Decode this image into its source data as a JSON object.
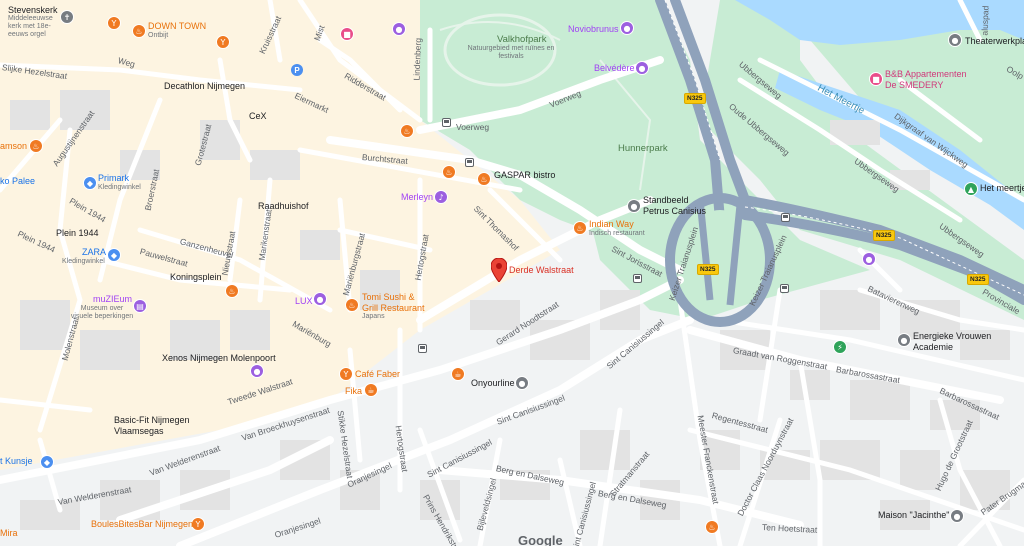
{
  "map": {
    "labels": {
      "stevenskerk": "Stevenskerk",
      "stevenskerk_sub": "Middeleeuwse kerk met 18e-eeuws orgel",
      "down_town": "DOWN TOWN",
      "down_town_sub": "Ontbijt",
      "decathlon": "Decathlon Nijmegen",
      "cex": "CeX",
      "samson": "amson",
      "primark": "Primark",
      "primark_sub": "Kledingwinkel",
      "ko_palee": "ko Palee",
      "plein1944": "Plein 1944",
      "raadhuishof": "Raadhuishof",
      "zara": "ZARA",
      "zara_sub": "Kledingwinkel",
      "koningsplein": "Koningsplein",
      "muzieum": "muZIEum",
      "muzieum_sub": "Museum over visuele beperkingen",
      "lux": "LUX",
      "xenos": "Xenos Nijmegen Molenpoort",
      "basicfit": "Basic-Fit Nijmegen Vlaamsegas",
      "kunsje": "t Kunsje",
      "mira": "Mira",
      "boules": "BoulesBitesBar Nijmegen",
      "valkhofpark": "Valkhofpark",
      "valkhofpark_sub": "Natuurgebied met ruïnes en festivals",
      "noviobrunus": "Noviobrunus",
      "belvedere": "Belvédère",
      "gaspar": "GASPAR bistro",
      "merleyn": "Merleyn",
      "hunnerpark": "Hunnerpark",
      "standbeeld": "Standbeeld Petrus Canisius",
      "indian_way": "Indian Way",
      "indian_way_sub": "Indisch restaurant",
      "derde_walstraat": "Derde Walstraat",
      "tomi_sushi": "Tomi Sushi & Grill Restaurant",
      "tomi_sushi_sub": "Japans",
      "cafe_faber": "Café Faber",
      "fika": "Fika",
      "onyourline": "Onyourline",
      "theaterwerkplaats": "Theaterwerkpla",
      "bb_appartementen": "B&B Appartementen De SMEDERY",
      "het_meertje": "Het meertje",
      "het_meertje_water": "Het Meertje",
      "energieke": "Energieke Vrouwen Academie",
      "maison": "Maison \"Jacinthe\"",
      "google": "Google"
    },
    "streets": {
      "slijke_hezelstraat": "Slijke Hezelstraat",
      "weg": "Weg",
      "augustijnenstraat": "Augustijnenstraat",
      "broerstraat": "Broerstraat",
      "plein1944_street": "Plein 1944",
      "molenstraat": "Molenstraat",
      "pauwelstraat": "Pauwelstraat",
      "nieuwstraat": "Nieuwstraat",
      "ganzenheuvel": "Ganzenheuvel",
      "grotestraat": "Grotestraat",
      "marikenstraat": "Marikenstraat",
      "ridderstraat": "Ridderstraat",
      "eiermarkt": "Eiermarkt",
      "burchtstraat": "Burchtstraat",
      "voerweg": "Voerweg",
      "voerweg2": "Voerweg",
      "lindenberg": "Lindenberg",
      "sint_thomashof": "Sint Thomashof",
      "hertogstraat": "Hertogstraat",
      "mariaenburgstraat": "Mariënburgstraat",
      "mariaenburg": "Mariënburg",
      "gerard_noodtstraat": "Gerard Noodtstraat",
      "sint_jorisstraat": "Sint Jorisstraat",
      "sint_canisiussingel": "Sint Canisiussingel",
      "sint_canisiussingel2": "Sint Canisiussingel",
      "sint_canisiussingel3": "Sint Canisiussingel",
      "tweede_walstraat": "Tweede Walstraat",
      "van_broeckhuysenstraat": "Van Broeckhuysenstraat",
      "van_welderenstraat": "Van Welderenstraat",
      "van_welderenstraat2": "Van Welderenstraat",
      "stikke_hezelstraat": "Stikke Hezelstraat",
      "hertogstraat2": "Hertogstraat",
      "oranjesingel": "Oranjesingel",
      "oranjesingel2": "Oranjesingel",
      "prins_hendrikstraat": "Prins Hendrikstraat",
      "bijleveldsingel": "Bijleveldsingel",
      "berg_en_dalseweg": "Berg en Dalseweg",
      "berg_en_dalseweg2": "Berg en Dalseweg",
      "sint_canisiussingel4": "Sint Canisiussingel",
      "stratmanstraat": "Stratmanstraat",
      "meester_franckenstraat": "Meester Franckenstraat",
      "regentesstraat": "Regentesstraat",
      "doctor_claas": "Doctor Claas Noorduynstraat",
      "graadt_van_roggenstraat": "Graadt van Roggenstraat",
      "barbarossastraat": "Barbarossastraat",
      "barbarossastraat2": "Barbarossastraat",
      "batavierenweg": "Batavierenweg",
      "hugo_de_grootstraat": "Hugo de Grootstraat",
      "pater_brugmanstraat": "Pater Brugmanstraat",
      "ten_hoetstraat": "Ten Hoetstraat",
      "keizer_traianusplein": "Keizer Traianusplein",
      "keizer_traianusplein2": "Keizer Traianusplein",
      "ubbergseweg": "Ubbergseweg",
      "ubbergseweg2": "Ubbergseweg",
      "ubbergseweg3": "Ubbergseweg",
      "oude_ubbergseweg": "Oude Ubbergseweg",
      "dijkgraaf": "Dijkgraaf van Wijckweg",
      "provinciale": "Provinciale",
      "oolp": "Oolp",
      "kruisstraat": "Kruisstraat",
      "mist": "Mist",
      "aluspad": "aluspad"
    },
    "shields": [
      "N325",
      "N325",
      "N325",
      "N325"
    ],
    "colors": {
      "park": "#c8ecd4",
      "water": "#aadaff",
      "road": "#ffffff",
      "highway": "#8ea0b8",
      "building": "#e8e8e8",
      "commercial": "#fdf3de",
      "pin_red": "#ea4335"
    }
  }
}
